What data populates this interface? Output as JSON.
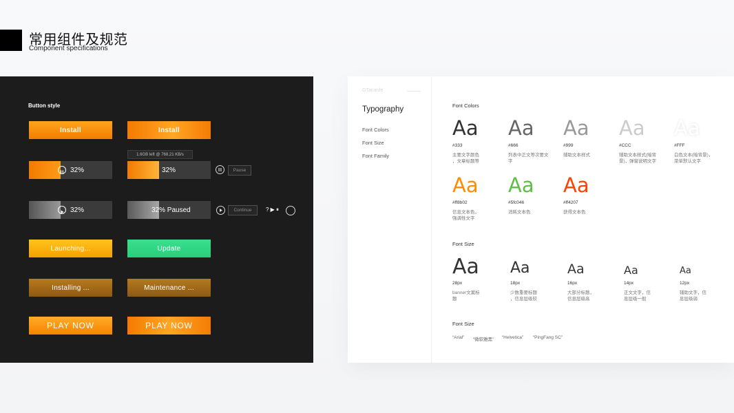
{
  "header": {
    "title": "常用组件及规范",
    "subtitle": "Component specifications"
  },
  "button_panel": {
    "title": "Button style",
    "install_label": "Install",
    "install_hover_label": "Install",
    "tooltip": "1.6GB left @ 768.21 KB/s",
    "progress_1": {
      "label": "32%",
      "value": 0.38
    },
    "progress_2": {
      "label": "32%",
      "value": 0.38
    },
    "pause_button": "Pause",
    "progress_3": {
      "label": "32%",
      "value": 0.38
    },
    "progress_4": {
      "label": "32% Paused",
      "value": 0.38
    },
    "continue_button": "Continue",
    "icons_legend": "? ▶ ⏸",
    "launching_label": "Launching...",
    "update_label": "Update",
    "installing_label": "Installing ...",
    "maintenance_label": "Maintenance ...",
    "play_label": "PLAY NOW",
    "play_hover_label": "PLAY NOW"
  },
  "typography_panel": {
    "brand": "GTacarde",
    "sidebar_title": "Typography",
    "nav": [
      "Font Colors",
      "Font Size",
      "Font Family"
    ],
    "font_colors": {
      "title": "Font Colors",
      "sample": "Aa",
      "items": [
        {
          "code": "#333",
          "color": "#333333",
          "desc": [
            "主要文字颜色",
            "，文章标题等"
          ]
        },
        {
          "code": "#666",
          "color": "#666666",
          "desc": [
            "列表中正文等次要文",
            "字"
          ]
        },
        {
          "code": "#999",
          "color": "#999999",
          "desc": [
            "辅助文本样式"
          ]
        },
        {
          "code": "#CCC",
          "color": "#cccccc",
          "desc": [
            "辅助文本样式(暗背",
            "景)，弹窗说明文字"
          ]
        },
        {
          "code": "#FFF",
          "color": "#ffffff",
          "desc": [
            "白色文本(暗背景)，",
            "菜单默认文字"
          ]
        },
        {
          "code": "#ff8b02",
          "color": "#ff8b02",
          "desc": [
            "信息文本色，",
            "强调性文字"
          ]
        },
        {
          "code": "#5fc046",
          "color": "#5fc046",
          "desc": [
            "消耗文本色"
          ]
        },
        {
          "code": "#ff4207",
          "color": "#ff4207",
          "desc": [
            "获得文本色"
          ]
        }
      ]
    },
    "font_size": {
      "title": "Font Size",
      "sample": "Aa",
      "items": [
        {
          "size": "28px",
          "desc": [
            "banner文案标",
            "题"
          ]
        },
        {
          "size": "18px",
          "desc": [
            "少数重要标题",
            "，信息层级较"
          ]
        },
        {
          "size": "16px",
          "desc": [
            "大部分标题，",
            "信息层级高"
          ]
        },
        {
          "size": "14px",
          "desc": [
            "正文文字，信",
            "息层级一般"
          ]
        },
        {
          "size": "12px",
          "desc": [
            "辅助文字，信",
            "息层级弱"
          ]
        }
      ]
    },
    "font_family": {
      "title": "Font Size",
      "items": [
        "“Arial”",
        "“微软雅黑”",
        "“Helvetica”",
        "“PingFang SC”"
      ]
    }
  }
}
